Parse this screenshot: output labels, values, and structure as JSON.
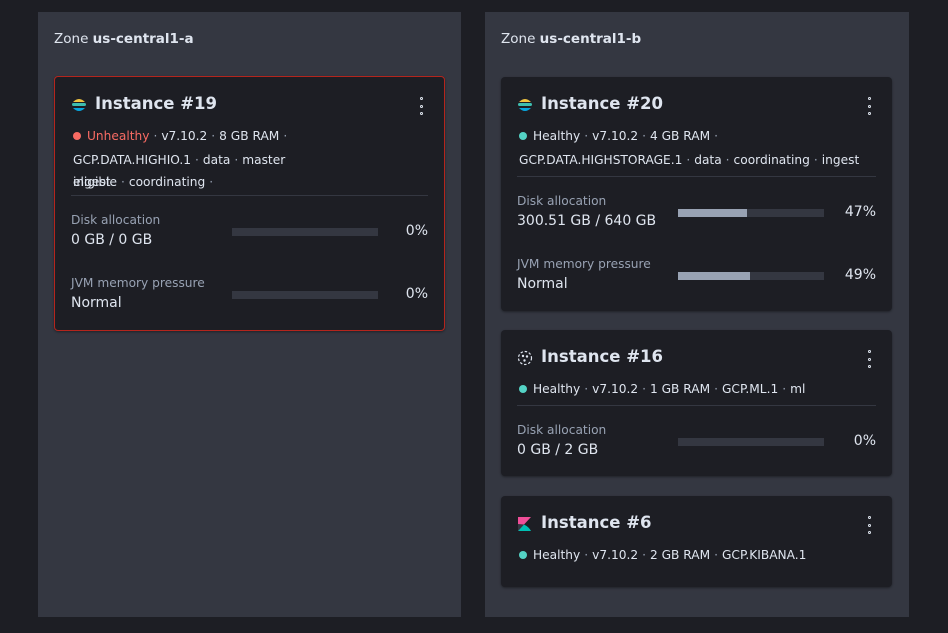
{
  "zones": [
    {
      "prefix": "Zone",
      "name": "us-central1-a",
      "instances": [
        {
          "title": "Instance #19",
          "icon": "elasticsearch-icon",
          "status": "Unhealthy",
          "status_color": "#f86b63",
          "version": "v7.10.2",
          "ram": "8 GB RAM",
          "instance_type": "GCP.DATA.HIGHIO.1",
          "roles": [
            "data",
            "master eligible",
            "coordinating",
            "ingest"
          ],
          "disk": {
            "label": "Disk allocation",
            "value": "0 GB / 0 GB",
            "percent_label": "0%",
            "percent": 0
          },
          "jvm": {
            "label": "JVM memory pressure",
            "value": "Normal",
            "percent_label": "0%",
            "percent": 0
          }
        }
      ]
    },
    {
      "prefix": "Zone",
      "name": "us-central1-b",
      "instances": [
        {
          "title": "Instance #20",
          "icon": "elasticsearch-icon",
          "status": "Healthy",
          "status_color": "#54d3c5",
          "version": "v7.10.2",
          "ram": "4 GB RAM",
          "instance_type": "GCP.DATA.HIGHSTORAGE.1",
          "roles": [
            "data",
            "coordinating",
            "ingest"
          ],
          "disk": {
            "label": "Disk allocation",
            "value": "300.51 GB / 640 GB",
            "percent_label": "47%",
            "percent": 47
          },
          "jvm": {
            "label": "JVM memory pressure",
            "value": "Normal",
            "percent_label": "49%",
            "percent": 49
          }
        },
        {
          "title": "Instance #16",
          "icon": "machine-learning-icon",
          "status": "Healthy",
          "status_color": "#54d3c5",
          "version": "v7.10.2",
          "ram": "1 GB RAM",
          "instance_type": "GCP.ML.1",
          "roles": [
            "ml"
          ],
          "disk": {
            "label": "Disk allocation",
            "value": "0 GB / 2 GB",
            "percent_label": "0%",
            "percent": 0
          }
        },
        {
          "title": "Instance #6",
          "icon": "kibana-icon",
          "status": "Healthy",
          "status_color": "#54d3c5",
          "version": "v7.10.2",
          "ram": "2 GB RAM",
          "instance_type": "GCP.KIBANA.1"
        }
      ]
    }
  ],
  "separator": "·"
}
